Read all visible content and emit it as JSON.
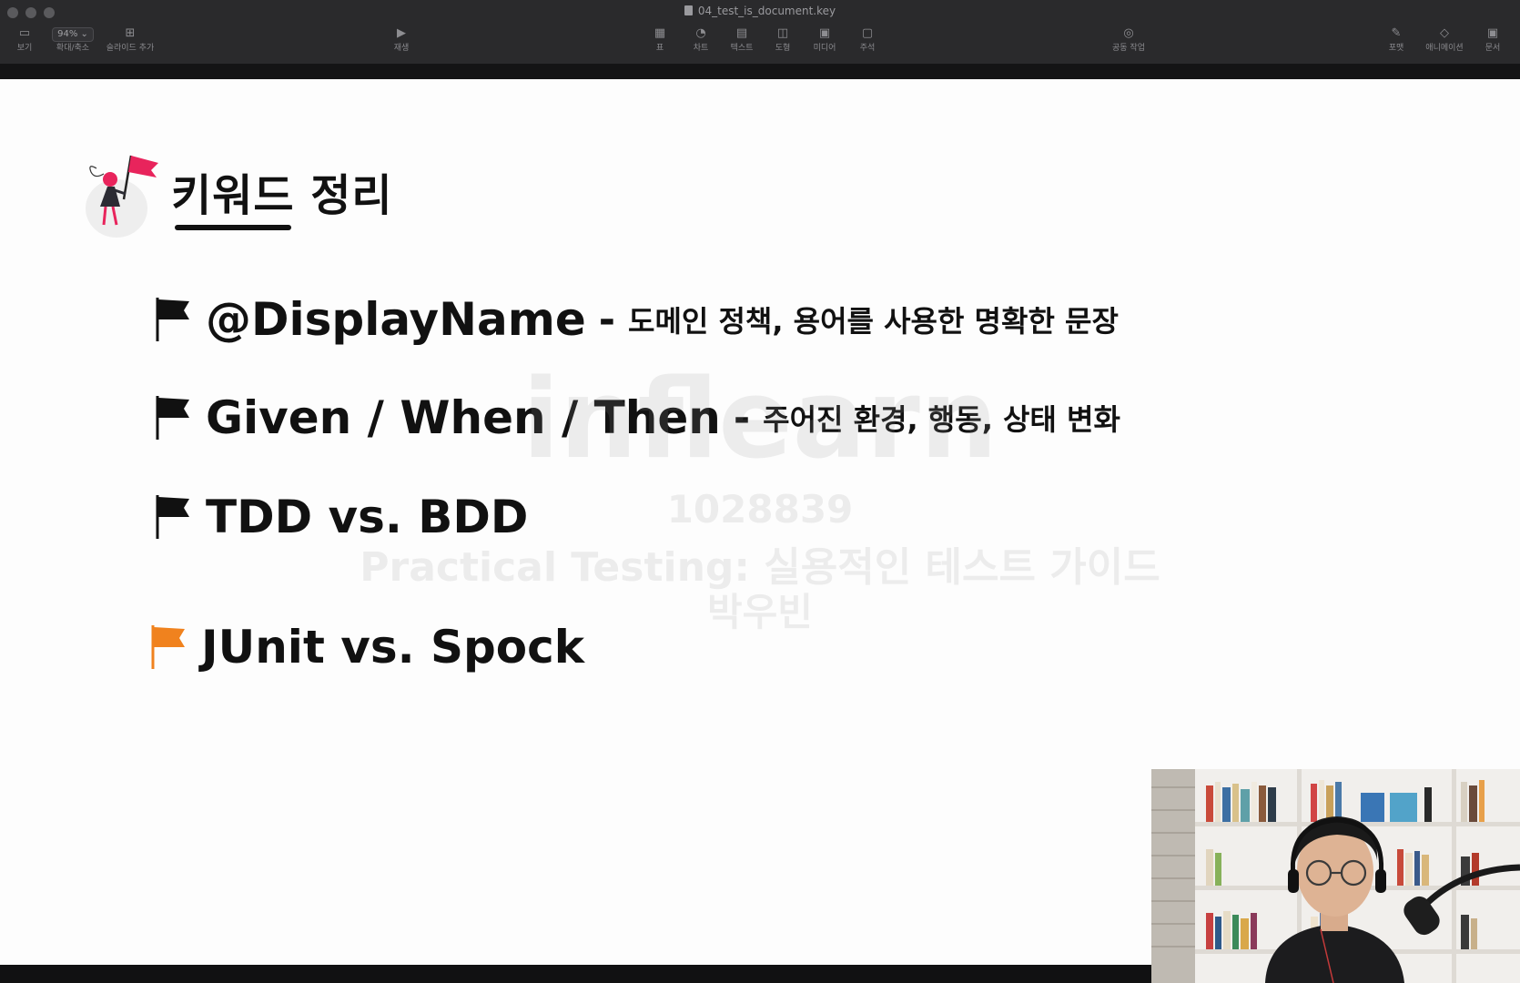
{
  "window": {
    "title": "04_test_is_document.key"
  },
  "toolbar": {
    "view_label": "보기",
    "zoom_value": "94%",
    "zoom_label": "확대/축소",
    "add_slide_label": "슬라이드 추가",
    "play_label": "재생",
    "table_label": "표",
    "chart_label": "차트",
    "text_label": "텍스트",
    "shape_label": "도형",
    "media_label": "미디어",
    "comment_label": "주석",
    "collaborate_label": "공동 작업",
    "format_label": "포맷",
    "animate_label": "애니메이션",
    "document_label": "문서"
  },
  "slide": {
    "title": "키워드 정리",
    "bullets": [
      {
        "keyword": "@DisplayName",
        "separator": "-",
        "description": "도메인 정책, 용어를 사용한 명확한 문장",
        "flag_color": "#111111"
      },
      {
        "keyword": "Given / When / Then",
        "separator": "-",
        "description": "주어진 환경, 행동, 상태 변화",
        "flag_color": "#111111"
      },
      {
        "keyword": "TDD vs. BDD",
        "flag_color": "#111111"
      },
      {
        "keyword": "JUnit vs. Spock",
        "flag_color": "#f0821e"
      }
    ]
  },
  "watermark": {
    "logo": "inflearn",
    "id": "1028839",
    "course": "Practical Testing: 실용적인 테스트 가이드",
    "author": "박우빈"
  },
  "colors": {
    "accent_flag_pink": "#e8245c",
    "active_flag_orange": "#f0821e",
    "toolbar_bg": "#2a2a2c"
  }
}
